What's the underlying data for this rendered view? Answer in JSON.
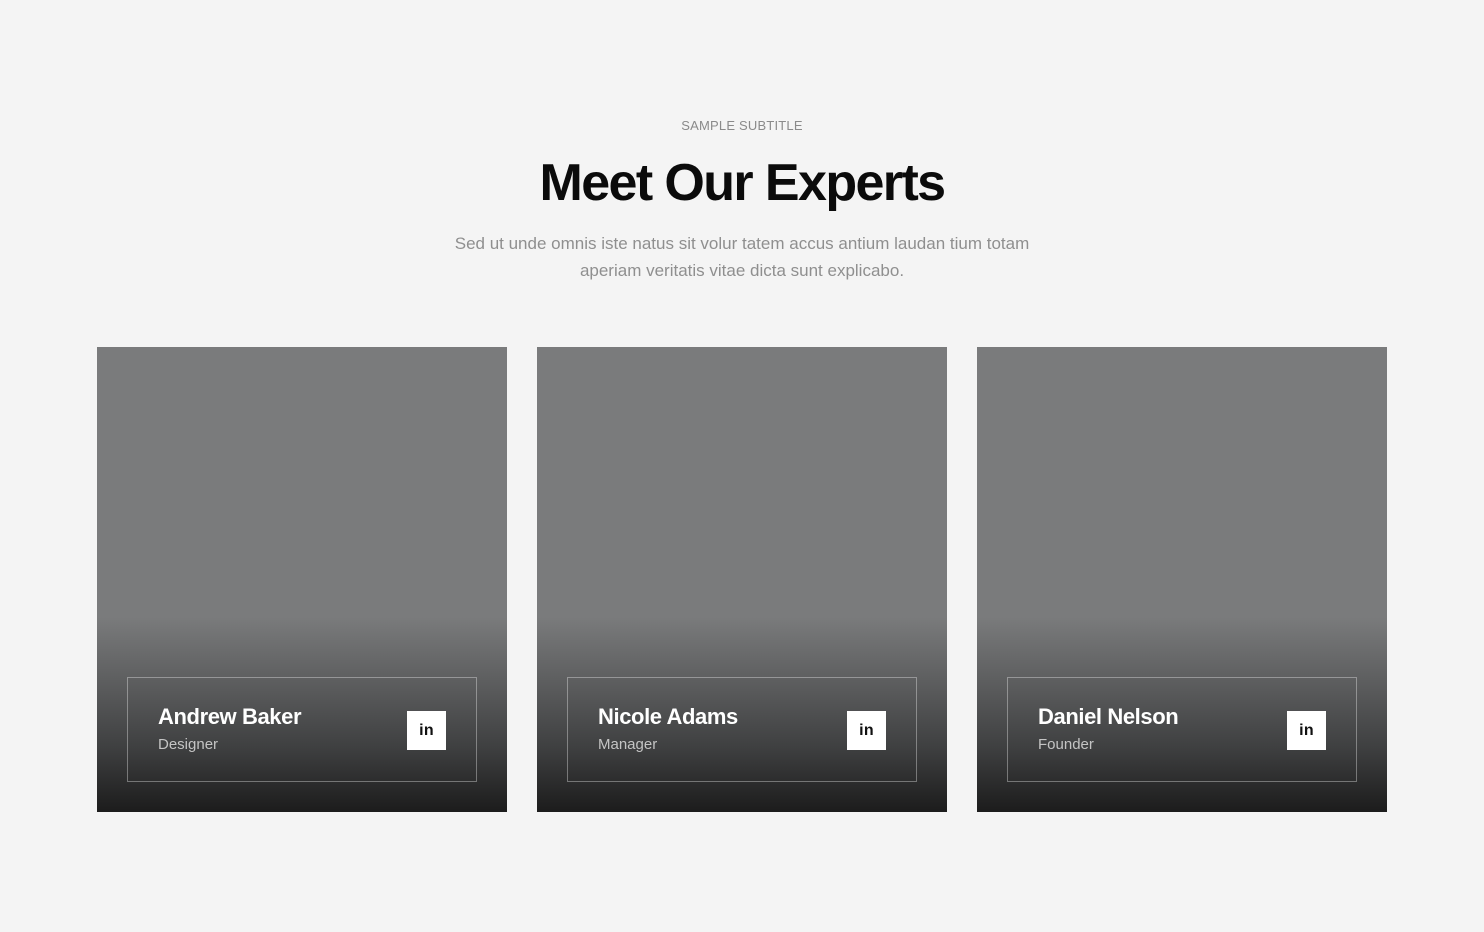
{
  "header": {
    "subtitle": "SAMPLE SUBTITLE",
    "title": "Meet Our Experts",
    "description": "Sed ut unde omnis iste natus sit volur tatem accus antium laudan tium totam aperiam veritatis vitae dicta sunt explicabo."
  },
  "team": [
    {
      "name": "Andrew Baker",
      "role": "Designer",
      "social_icon": "in"
    },
    {
      "name": "Nicole Adams",
      "role": "Manager",
      "social_icon": "in"
    },
    {
      "name": "Daniel Nelson",
      "role": "Founder",
      "social_icon": "in"
    }
  ],
  "colors": {
    "background": "#f4f4f4",
    "title": "#0b0b0b",
    "muted_text": "#8f8f8f",
    "card_top": "#7a7b7c",
    "card_bottom": "#1c1c1c",
    "card_text": "#ffffff",
    "social_button_bg": "#ffffff"
  }
}
